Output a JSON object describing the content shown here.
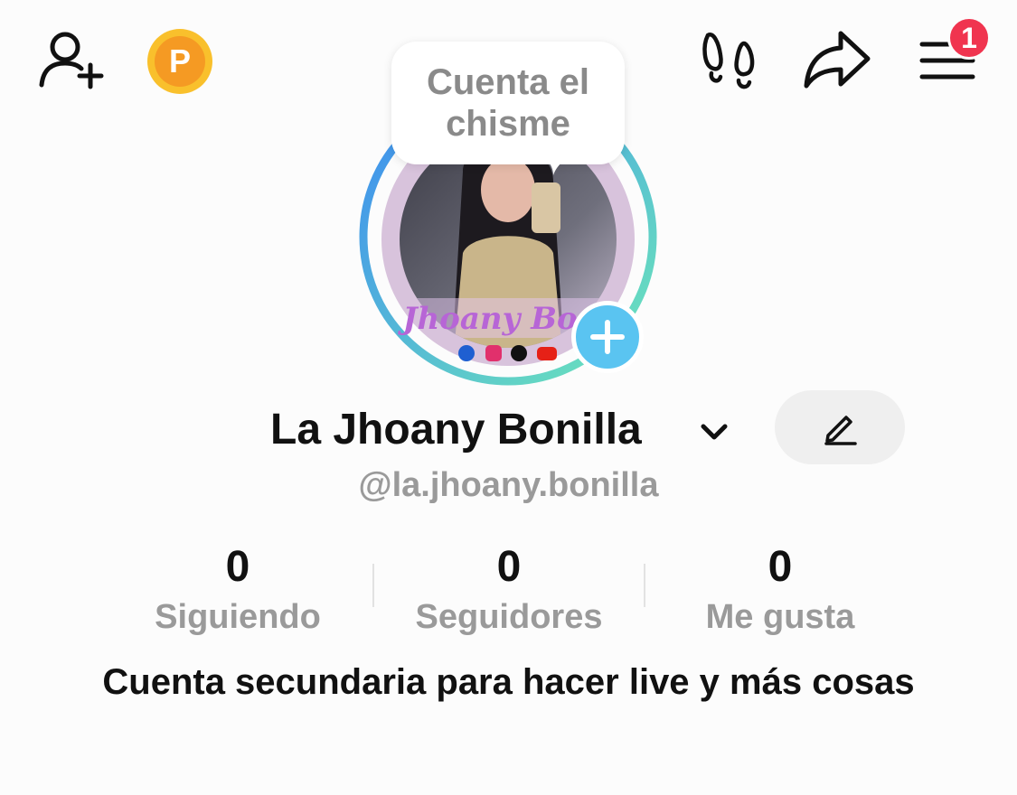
{
  "header": {
    "add_friend_icon": "person-add-icon",
    "promote_badge_letter": "P",
    "footprints_icon": "footprints-icon",
    "share_icon": "share-arrow-icon",
    "menu_icon": "hamburger-menu-icon",
    "notification_count": "1"
  },
  "profile": {
    "tooltip_text": "Cuenta el chisme",
    "display_name": "La Jhoany Bonilla",
    "username": "@la.jhoany.bonilla",
    "bio": "Cuenta secundaria para hacer live y más cosas",
    "avatar_watermark": "Jhoany Bo",
    "avatar_social_icons": [
      "facebook-icon",
      "instagram-icon",
      "tiktok-icon",
      "youtube-icon"
    ]
  },
  "stats": [
    {
      "value": "0",
      "label": "Siguiendo"
    },
    {
      "value": "0",
      "label": "Seguidores"
    },
    {
      "value": "0",
      "label": "Me gusta"
    }
  ],
  "colors": {
    "badge_red": "#f0344f",
    "add_story_blue": "#5ac4f1",
    "promote_orange": "#f59a23",
    "ring_start": "#3d8bf2",
    "ring_end": "#6de8b8"
  }
}
